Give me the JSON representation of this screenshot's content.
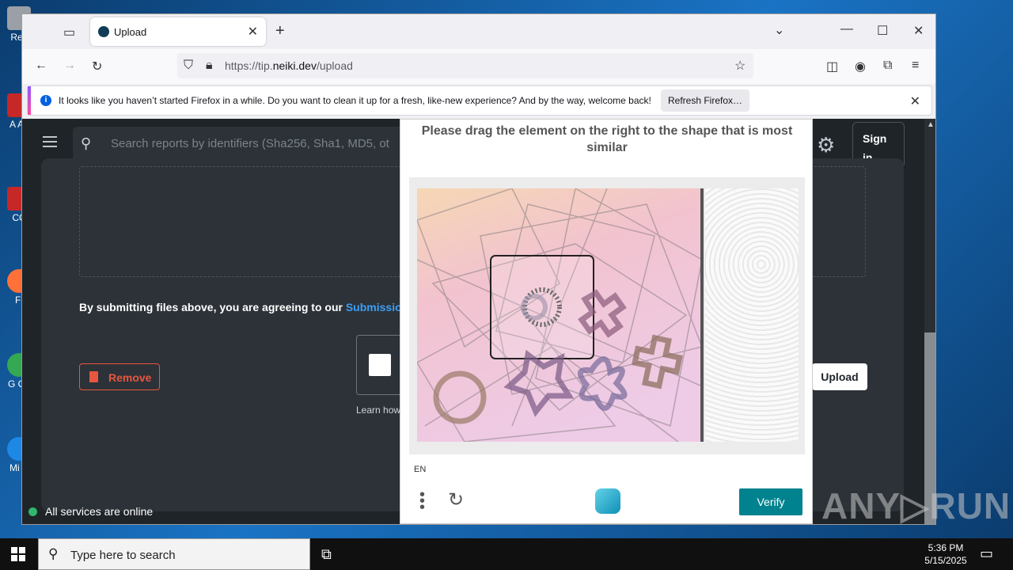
{
  "desktop": {
    "icons": [
      {
        "label": "Rec",
        "color": "#9aa0a6"
      },
      {
        "label": "A Ac",
        "color": "#c62828"
      },
      {
        "label": "CC",
        "color": "#c62828"
      },
      {
        "label": "Fi",
        "color": "#ff7139"
      },
      {
        "label": "G Ch",
        "color": "#34a853"
      },
      {
        "label": "Mi E",
        "color": "#1e88e5"
      }
    ]
  },
  "browser": {
    "tab_title": "Upload",
    "url_prefix": "https://tip.",
    "url_domain": "neiki.dev",
    "url_path": "/upload",
    "notification": {
      "message": "It looks like you haven’t started Firefox in a while. Do you want to clean it up for a fresh, like-new experience? And by the way, welcome back!",
      "button": "Refresh Firefox…"
    }
  },
  "page": {
    "search_placeholder": "Search reports by identifiers (Sha256, Sha1, MD5, ot",
    "signin": "Sign in",
    "terms_text": "By submitting files above, you are agreeing to our ",
    "terms_link": "Submission",
    "remove_button": "Remove",
    "learn_text": "Learn how",
    "upload_button": "Upload",
    "status_text": "All services are online"
  },
  "captcha": {
    "prompt": "Please drag the element on the right to the shape that is most similar",
    "language": "EN",
    "verify_button": "Verify"
  },
  "taskbar": {
    "search_placeholder": "Type here to search",
    "time": "5:36 PM",
    "date": "5/15/2025"
  },
  "watermark": "ANY▷RUN"
}
